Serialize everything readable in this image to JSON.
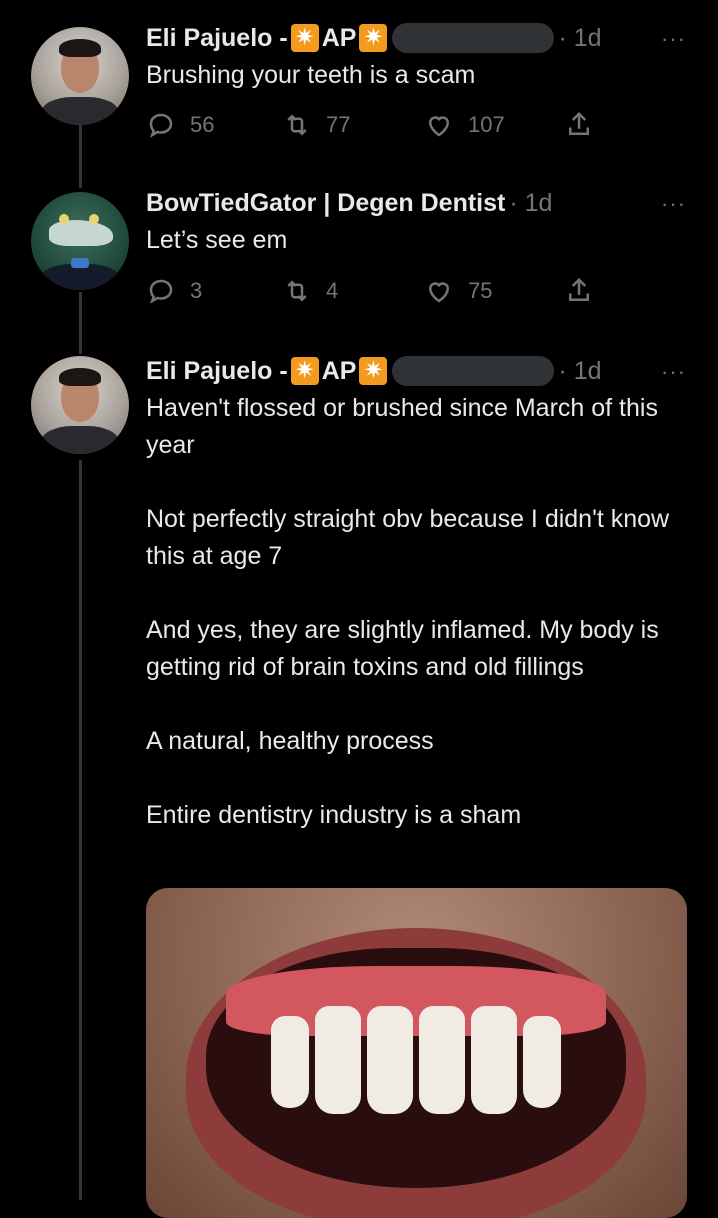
{
  "tweets": [
    {
      "name": "Eli Pajuelo - ",
      "badge_text": "AP",
      "badge_glyph": "✷",
      "time": "· 1d",
      "more": "···",
      "text": [
        "Brushing your teeth is a scam"
      ],
      "reply_count": "56",
      "retweet_count": "77",
      "like_count": "107"
    },
    {
      "name": "BowTiedGator | Degen Dentist",
      "time": "· 1d",
      "more": "···",
      "text": [
        "Let’s see em"
      ],
      "reply_count": "3",
      "retweet_count": "4",
      "like_count": "75"
    },
    {
      "name": "Eli Pajuelo - ",
      "badge_text": "AP",
      "badge_glyph": "✷",
      "time": "· 1d",
      "more": "···",
      "text": [
        "Haven't flossed or brushed since March of this year",
        "Not perfectly straight obv because I didn't know this at age 7",
        "And yes, they are slightly inflamed. My body is getting rid of brain toxins and old fillings",
        "A natural, healthy process",
        "Entire dentistry industry is a sham"
      ]
    }
  ],
  "colors": {
    "background": "#000000",
    "text": "#e7e9ea",
    "muted": "#71767b",
    "badge": "#f29b1e",
    "thread_line": "#333639"
  },
  "icons": [
    "reply-icon",
    "retweet-icon",
    "like-icon",
    "share-icon"
  ]
}
